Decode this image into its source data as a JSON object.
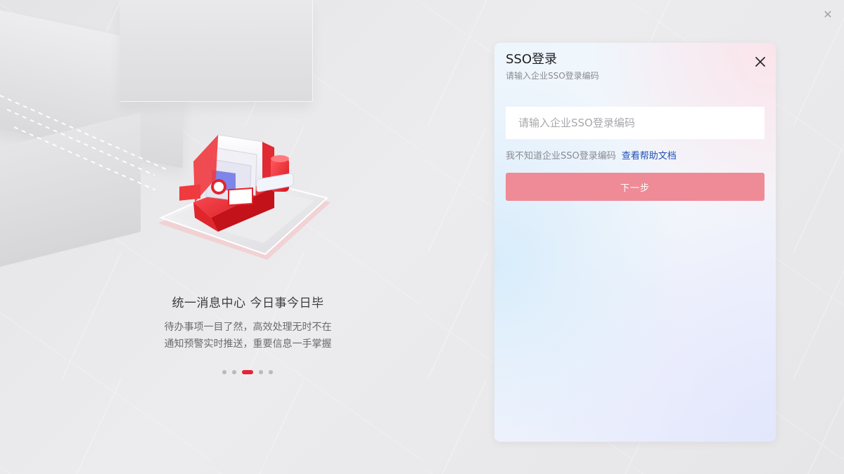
{
  "window": {
    "close_icon": "close-icon"
  },
  "carousel": {
    "title": "统一消息中心  今日事今日毕",
    "description_line1": "待办事项一目了然，高效处理无时不在",
    "description_line2": "通知预警实时推送，重要信息一手掌握",
    "slide_count": 5,
    "active_index": 2,
    "accent_color": "#e0263a"
  },
  "login": {
    "title": "SSO登录",
    "subtitle": "请输入企业SSO登录编码",
    "input_placeholder": "请输入企业SSO登录编码",
    "input_value": "",
    "help_text": "我不知道企业SSO登录编码",
    "help_link": "查看帮助文档",
    "next_button": "下一步",
    "button_color": "#ef8b96",
    "link_color": "#1f4fb8"
  }
}
